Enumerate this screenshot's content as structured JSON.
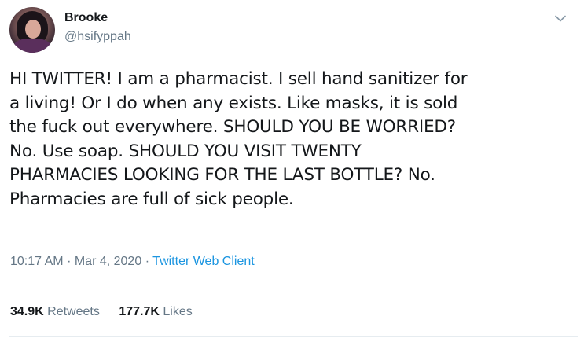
{
  "tweet": {
    "author_name": "Brooke",
    "author_handle": "@hsifyppah",
    "text": "HI TWITTER! I am a pharmacist. I sell hand sanitizer for\na living! Or I do when any exists. Like masks, it is sold\nthe fuck out everywhere. SHOULD YOU BE WORRIED?\nNo. Use soap. SHOULD YOU VISIT TWENTY\nPHARMACIES LOOKING FOR THE LAST BOTTLE? No.\nPharmacies are full of sick people.",
    "time": "10:17 AM",
    "separator": "·",
    "date": "Mar 4, 2020",
    "client": "Twitter Web Client",
    "retweets_count": "34.9K",
    "retweets_label": "Retweets",
    "likes_count": "177.7K",
    "likes_label": "Likes"
  },
  "icons": {
    "menu": "chevron-down-icon"
  },
  "colors": {
    "text": "#14171a",
    "secondary": "#657786",
    "link": "#1b95e0",
    "divider": "#e6ecf0"
  }
}
